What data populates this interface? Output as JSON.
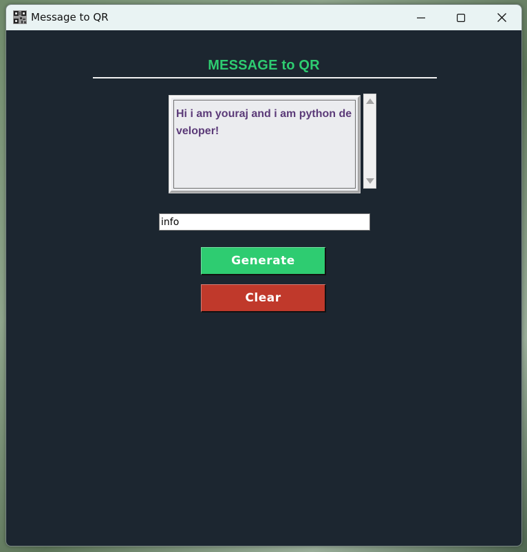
{
  "window": {
    "title": "Message to QR",
    "icon": "qr-code-icon"
  },
  "controls": {
    "minimize_icon": "minimize-icon",
    "maximize_icon": "maximize-icon",
    "close_icon": "close-icon"
  },
  "main": {
    "heading": "MESSAGE to QR",
    "message_text": "Hi i am youraj and i am python developer!",
    "filename_value": "info",
    "generate_label": "Generate",
    "clear_label": "Clear"
  },
  "colors": {
    "background": "#1c2630",
    "heading": "#2ecc71",
    "generate_button": "#2ecc71",
    "clear_button": "#c0392b",
    "message_text": "#5b3a78",
    "titlebar": "#e9f3f3"
  }
}
